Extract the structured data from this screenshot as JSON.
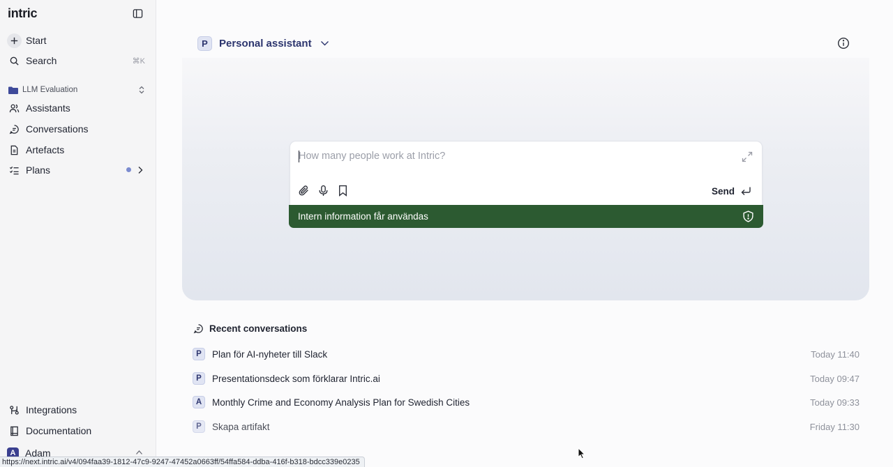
{
  "app": {
    "logo": "intric"
  },
  "sidebar": {
    "start": {
      "label": "Start",
      "icon": "plus-icon"
    },
    "search": {
      "label": "Search",
      "shortcut": "⌘K",
      "icon": "search-icon"
    },
    "space": {
      "label": "LLM Evaluation",
      "icon": "folder-icon"
    },
    "items": [
      {
        "label": "Assistants",
        "icon": "users-icon"
      },
      {
        "label": "Conversations",
        "icon": "chat-icon"
      },
      {
        "label": "Artefacts",
        "icon": "document-icon"
      },
      {
        "label": "Plans",
        "icon": "list-check-icon"
      }
    ],
    "footer": [
      {
        "label": "Integrations",
        "icon": "integrations-icon"
      },
      {
        "label": "Documentation",
        "icon": "book-icon"
      }
    ],
    "user": {
      "name": "Adam",
      "initial": "A"
    }
  },
  "header": {
    "assistant_initial": "P",
    "assistant_name": "Personal assistant"
  },
  "prompt": {
    "placeholder": "How many people work at Intric?",
    "send_label": "Send",
    "security_text": "Intern information får användas"
  },
  "recent": {
    "title": "Recent conversations",
    "rows": [
      {
        "initial": "P",
        "title": "Plan för AI-nyheter till Slack",
        "time": "Today 11:40"
      },
      {
        "initial": "P",
        "title": "Presentationsdeck som förklarar Intric.ai",
        "time": "Today 09:47"
      },
      {
        "initial": "A",
        "title": "Monthly Crime and Economy Analysis Plan for Swedish Cities",
        "time": "Today 09:33"
      },
      {
        "initial": "P",
        "title": "Skapa artifakt",
        "time": "Friday 11:30"
      }
    ]
  },
  "status_url": "https://next.intric.ai/v4/094faa39-1812-47c9-9247-47452a0663ff/54ffa584-ddba-416f-b318-bdcc339e0235",
  "colors": {
    "security_bar": "#2c5a31",
    "accent": "#2c356e",
    "plans_dot": "#7b8bcf"
  }
}
